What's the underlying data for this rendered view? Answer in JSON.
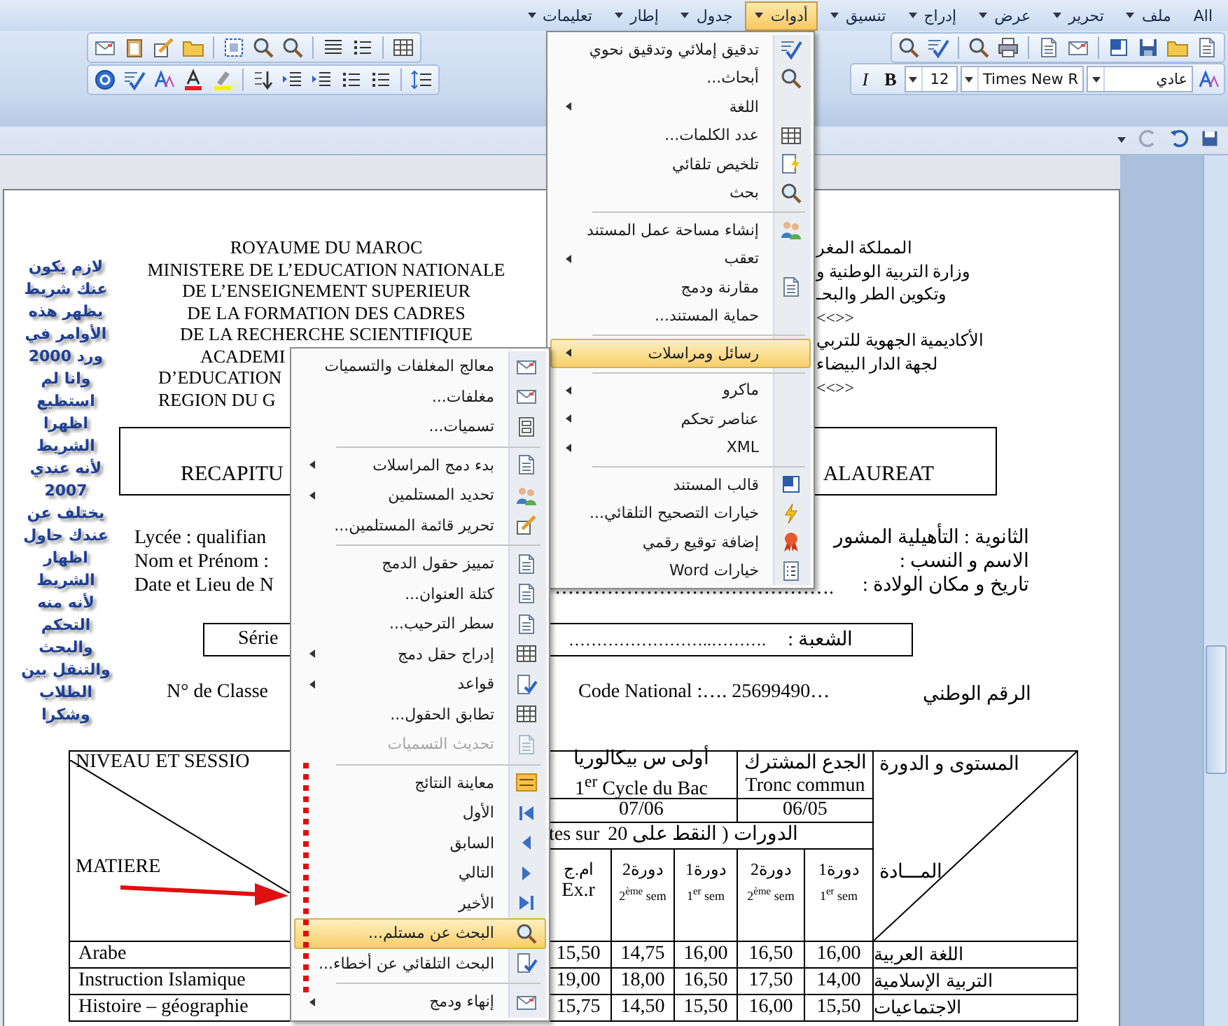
{
  "menubar": {
    "items": [
      {
        "label": "All",
        "selected": false,
        "has_dropdown": false
      },
      {
        "label": "ملف",
        "selected": false,
        "has_dropdown": true
      },
      {
        "label": "تحرير",
        "selected": false,
        "has_dropdown": true
      },
      {
        "label": "عرض",
        "selected": false,
        "has_dropdown": true
      },
      {
        "label": "إدراج",
        "selected": false,
        "has_dropdown": true
      },
      {
        "label": "تنسيق",
        "selected": false,
        "has_dropdown": true
      },
      {
        "label": "أدوات",
        "selected": true,
        "has_dropdown": true
      },
      {
        "label": "جدول",
        "selected": false,
        "has_dropdown": true
      },
      {
        "label": "إطار",
        "selected": false,
        "has_dropdown": true
      },
      {
        "label": "تعليمات",
        "selected": false,
        "has_dropdown": true
      }
    ]
  },
  "toolbar": {
    "style": "عادي",
    "font": "Times New R",
    "size": "12",
    "bold": "B",
    "italic": "I"
  },
  "tools_menu": {
    "groups": [
      [
        {
          "label": "تدقيق إملائي وتدقيق نحوي",
          "submenu": false,
          "selected": false
        },
        {
          "label": "أبحاث...",
          "submenu": false,
          "selected": false
        },
        {
          "label": "اللغة",
          "submenu": true,
          "selected": false
        },
        {
          "label": "عدد الكلمات...",
          "submenu": false,
          "selected": false
        },
        {
          "label": "تلخيص تلقائي",
          "submenu": false,
          "selected": false
        },
        {
          "label": "بحث",
          "submenu": false,
          "selected": false
        }
      ],
      [
        {
          "label": "إنشاء مساحة عمل المستند",
          "submenu": false,
          "selected": false
        },
        {
          "label": "تعقب",
          "submenu": true,
          "selected": false
        },
        {
          "label": "مقارنة ودمج",
          "submenu": false,
          "selected": false
        },
        {
          "label": "حماية المستند...",
          "submenu": false,
          "selected": false
        }
      ],
      [
        {
          "label": "رسائل ومراسلات",
          "submenu": true,
          "selected": true
        }
      ],
      [
        {
          "label": "ماكرو",
          "submenu": true,
          "selected": false
        },
        {
          "label": "عناصر تحكم",
          "submenu": true,
          "selected": false
        },
        {
          "label": "XML",
          "submenu": true,
          "selected": false
        }
      ],
      [
        {
          "label": "قالب المستند",
          "submenu": false,
          "selected": false
        },
        {
          "label": "خيارات التصحيح التلقائي...",
          "submenu": false,
          "selected": false
        },
        {
          "label": "إضافة توقيع رقمي",
          "submenu": false,
          "selected": false
        },
        {
          "label": "خيارات Word",
          "submenu": false,
          "selected": false
        }
      ]
    ]
  },
  "mailings_submenu": {
    "groups": [
      [
        {
          "label": "معالج المغلفات والتسميات",
          "submenu": false,
          "selected": false,
          "disabled": false
        },
        {
          "label": "مغلفات...",
          "submenu": false,
          "selected": false,
          "disabled": false
        },
        {
          "label": "تسميات...",
          "submenu": false,
          "selected": false,
          "disabled": false
        }
      ],
      [
        {
          "label": "بدء دمج المراسلات",
          "submenu": true,
          "selected": false,
          "disabled": false
        },
        {
          "label": "تحديد المستلمين",
          "submenu": true,
          "selected": false,
          "disabled": false
        },
        {
          "label": "تحرير قائمة المستلمين...",
          "submenu": false,
          "selected": false,
          "disabled": false
        }
      ],
      [
        {
          "label": "تمييز حقول الدمج",
          "submenu": false,
          "selected": false,
          "disabled": false
        },
        {
          "label": "كتلة العنوان...",
          "submenu": false,
          "selected": false,
          "disabled": false
        },
        {
          "label": "سطر الترحيب...",
          "submenu": false,
          "selected": false,
          "disabled": false
        },
        {
          "label": "إدراج حقل دمج",
          "submenu": true,
          "selected": false,
          "disabled": false
        },
        {
          "label": "قواعد",
          "submenu": true,
          "selected": false,
          "disabled": false
        },
        {
          "label": "تطابق الحقول...",
          "submenu": false,
          "selected": false,
          "disabled": false
        },
        {
          "label": "تحديث التسميات",
          "submenu": false,
          "selected": false,
          "disabled": true
        }
      ],
      [
        {
          "label": "معاينة النتائج",
          "submenu": false,
          "selected": false,
          "disabled": false
        },
        {
          "label": "الأول",
          "submenu": false,
          "selected": false,
          "disabled": false
        },
        {
          "label": "السابق",
          "submenu": false,
          "selected": false,
          "disabled": false
        },
        {
          "label": "التالي",
          "submenu": false,
          "selected": false,
          "disabled": false
        },
        {
          "label": "الأخير",
          "submenu": false,
          "selected": false,
          "disabled": false
        },
        {
          "label": "البحث عن مستلم...",
          "submenu": false,
          "selected": true,
          "disabled": false
        },
        {
          "label": "البحث التلقائي عن أخطاء...",
          "submenu": false,
          "selected": false,
          "disabled": false
        }
      ],
      [
        {
          "label": "إنهاء ودمج",
          "submenu": true,
          "selected": false,
          "disabled": false
        }
      ]
    ]
  },
  "note": {
    "text": "لازم يكون\nعنك شريط\nيظهر هذه\nالأوامر في\nورد 2000\nوانا لم\nاستطيع\nاظهرا\nالشريط\nلأنه عندي\n2007\nيختلف عن\nعندك حاول\nاظهار\nالشريط\nلأنه منه\nالتحكم\nوالبحث\nوالتنقل بين\nالطلاب\nوشكرا"
  },
  "document": {
    "header_left": [
      "ROYAUME DU MAROC",
      "MINISTERE DE L’EDUCATION NATIONALE",
      "DE L’ENSEIGNEMENT SUPERIEUR",
      "DE LA FORMATION DES CADRES",
      "DE LA RECHERCHE SCIENTIFIQUE",
      "ACADEMI",
      "D’EDUCATION",
      "REGION DU G"
    ],
    "header_right": [
      "المملكة المغر",
      "وزارة التربية الوطنية و",
      "وتكوين الطر والبحـ",
      "<<>>",
      "الأكاديمية الجهوية للتربي",
      "لجهة الدار البيضاء",
      "<<>>"
    ],
    "title_box": {
      "left": "RECAPITU",
      "right": "ALAUREAT"
    },
    "info_rows": [
      {
        "left": "Lycée :  qualifian",
        "right": "الثانوية : التأهيلية المشور"
      },
      {
        "left": "Nom et Prénom :",
        "right": "الاسم و النسب :"
      },
      {
        "left": "Date et Lieu de N",
        "middle": "…………………………………….",
        "right": "تاريخ و مكان الولادة :"
      }
    ],
    "serie": {
      "left": "Série",
      "dots": "……………………..……….",
      "right": "الشعبة :"
    },
    "class_row": {
      "left": "N° de Classe",
      "code": "Code National :…. 25699490…",
      "right": "الرقم الوطني"
    },
    "table": {
      "left_top": "NIVEAU ET SESSIO",
      "left_bottom": "MATIERE",
      "right_top": "المستوى و الدورة",
      "right_bottom": "المـــادة",
      "levels": [
        {
          "ar": "الجدع المشترك",
          "fr": "Tronc commun",
          "year": "06/05"
        },
        {
          "ar": "أولى س بيكالوريا",
          "fr": "1$^{er}$ Cycle du Bac",
          "year": "07/06"
        }
      ],
      "sessions_fr": "tes sur",
      "sessions_ar": "الدورات ( النقط على 20",
      "columns": [
        {
          "ar": "دورة1",
          "fr": "1$^{er}$ sem"
        },
        {
          "ar": "دورة2",
          "fr": "2$^{ème}$ sem"
        },
        {
          "ar": "دورة1",
          "fr": "1$^{er}$ sem"
        },
        {
          "ar": "دورة2",
          "fr": "2$^{ème}$ sem"
        },
        {
          "ar": "ام.ج",
          "fr": "Ex.r"
        }
      ],
      "rows": [
        {
          "subject_ar": "اللغة العربية",
          "values": [
            "16,00",
            "16,50",
            "16,00",
            "14,75",
            "15,50"
          ],
          "subject": "Arabe"
        },
        {
          "subject_ar": "التربية الإسلامية",
          "values": [
            "14,00",
            "17,50",
            "16,50",
            "18,00",
            "19,00"
          ],
          "subject": "Instruction Islamique"
        },
        {
          "subject_ar": "الاجتماعيات",
          "values": [
            "15,50",
            "16,00",
            "15,50",
            "14,50",
            "15,75"
          ],
          "subject": "Histoire – géographie"
        }
      ]
    }
  }
}
